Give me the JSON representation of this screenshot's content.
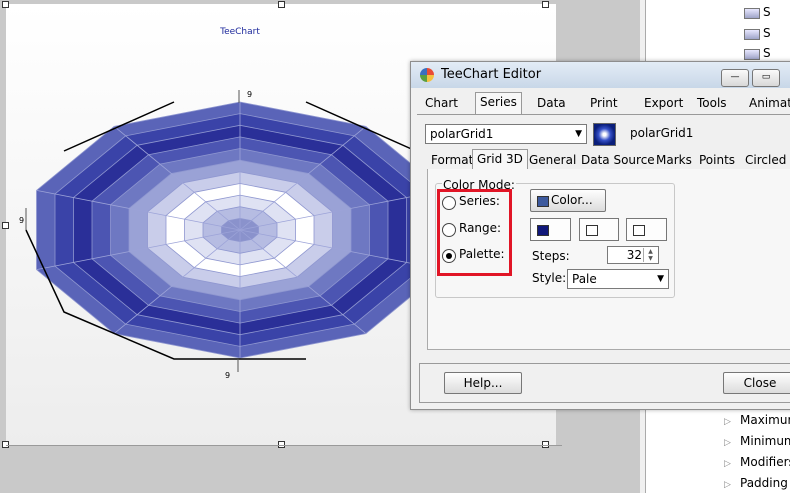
{
  "chart": {
    "title": "TeeChart",
    "labels": {
      "top": "9",
      "left": "9",
      "bottom": "9"
    }
  },
  "tree": {
    "items": [
      "S",
      "S",
      "S"
    ]
  },
  "properties": {
    "items": [
      "Maximur",
      "Minimum",
      "Modifiers",
      "Padding"
    ]
  },
  "editor": {
    "title": "TeeChart Editor",
    "window_buttons": {
      "minimize": "—",
      "maximize": "▭"
    },
    "tabs": [
      "Chart",
      "Series",
      "Data",
      "Print",
      "Export",
      "Tools",
      "Animati"
    ],
    "series_select": "polarGrid1",
    "series_name": "polarGrid1",
    "inner_tabs": [
      "Format",
      "Grid 3D",
      "General",
      "Data Source",
      "Marks",
      "Points",
      "Circled"
    ],
    "color_mode_label": "Color Mode:",
    "radios": [
      {
        "label": "Series:",
        "checked": false
      },
      {
        "label": "Range:",
        "checked": false
      },
      {
        "label": "Palette:",
        "checked": true
      }
    ],
    "color_button": "Color...",
    "steps_label": "Steps:",
    "steps_value": "32",
    "style_label": "Style:",
    "style_value": "Pale",
    "help_button": "Help...",
    "close_button": "Close",
    "colors": {
      "series_color": "#3d5a9e",
      "range_start": "#10187a",
      "accent": "#e11526"
    }
  }
}
